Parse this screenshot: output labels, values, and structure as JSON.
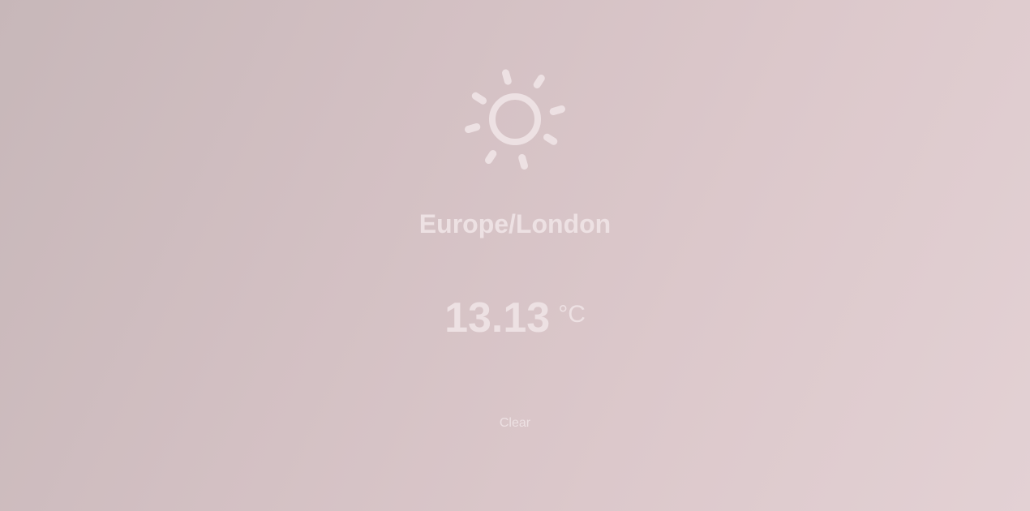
{
  "weather": {
    "icon": "sun-icon",
    "location": "Europe/London",
    "temperature": "13.13",
    "unit": "°C",
    "condition": "Clear"
  },
  "colors": {
    "background_start": "#c7b7b9",
    "background_end": "#e3d1d4",
    "text": "#ede1e3"
  }
}
